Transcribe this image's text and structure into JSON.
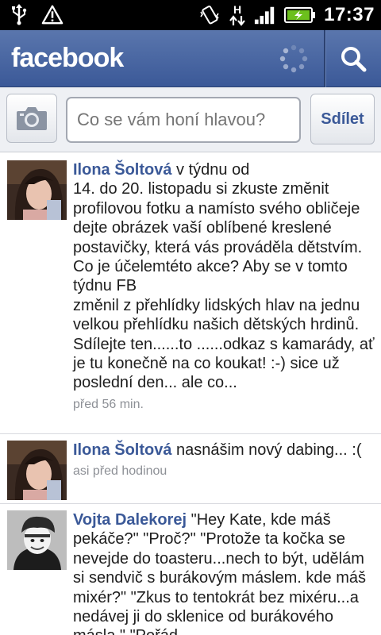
{
  "status_bar": {
    "time": "17:37",
    "icons": [
      "usb-icon",
      "warning-icon",
      "vibrate-icon",
      "hspa-data-icon",
      "signal-icon",
      "battery-charging-icon"
    ],
    "network_label": "H"
  },
  "header": {
    "logo": "facebook",
    "icons": [
      "loading-spinner-icon",
      "search-icon"
    ]
  },
  "composer": {
    "placeholder": "Co se vám honí hlavou?",
    "share_label": "Sdílet",
    "camera_icon": "camera-icon"
  },
  "feed": [
    {
      "author": "Ilona Šoltová",
      "text": "v týdnu od\n14. do 20. listopadu si zkuste změnit profilovou fotku a namísto svého obličeje dejte obrázek vaší oblíbené kreslené postavičky, která vás prováděla dětstvím. Co je účelemtéto akce? Aby se v tomto týdnu FB\nzměnil z přehlídky lidských hlav na jednu velkou přehlídku našich dětských hrdinů. Sdílejte ten......to ......odkaz s kamarády, ať\nje tu konečně na co koukat! :-)  sice už poslední den... ale co...",
      "time": "před 56 min."
    },
    {
      "author": "Ilona Šoltová",
      "text": "nasnášim nový dabing... :(",
      "time": "asi před hodinou"
    },
    {
      "author": "Vojta Dalekorej",
      "text": "\"Hey Kate, kde máš pekáče?\" \"Proč?\" \"Protože ta kočka se nevejde do toasteru...nech to být, udělám si sendvič s burákovým máslem. kde máš mixér?\" \"Zkus to tentokrát bez mixéru...a nedávej ji do sklenice od burákového másla.\" \"Pořád ...",
      "time": ""
    }
  ]
}
